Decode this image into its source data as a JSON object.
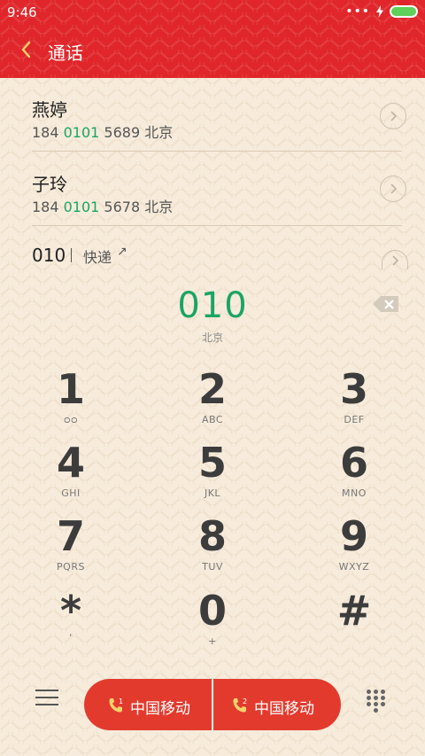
{
  "status": {
    "time": "9:46",
    "dots": "•••"
  },
  "header": {
    "title": "通话"
  },
  "contacts": [
    {
      "name": "燕婷",
      "num_pre": "184 ",
      "num_hl": "0101",
      "num_post": " 5689  北京"
    },
    {
      "name": "子玲",
      "num_pre": "184 ",
      "num_hl": "0101",
      "num_post": " 5678  北京"
    }
  ],
  "quick": {
    "number": "010",
    "link": "快递",
    "arrow": "↗"
  },
  "input": {
    "number": "010",
    "location": "北京"
  },
  "keys": [
    {
      "digit": "1",
      "letters": "ᴑᴑ"
    },
    {
      "digit": "2",
      "letters": "ABC"
    },
    {
      "digit": "3",
      "letters": "DEF"
    },
    {
      "digit": "4",
      "letters": "GHI"
    },
    {
      "digit": "5",
      "letters": "JKL"
    },
    {
      "digit": "6",
      "letters": "MNO"
    },
    {
      "digit": "7",
      "letters": "PQRS"
    },
    {
      "digit": "8",
      "letters": "TUV"
    },
    {
      "digit": "9",
      "letters": "WXYZ"
    },
    {
      "digit": "*",
      "letters": ","
    },
    {
      "digit": "0",
      "letters": "+"
    },
    {
      "digit": "#",
      "letters": ""
    }
  ],
  "call": {
    "sim1_label": "中国移动",
    "sim2_label": "中国移动",
    "sim1_index": "1",
    "sim2_index": "2"
  },
  "colors": {
    "header": "#e0262a",
    "accent_green": "#1aa564",
    "call_button": "#e23b2e"
  },
  "icons": [
    "back-icon",
    "battery-icon",
    "charging-icon",
    "chevron-right-icon",
    "backspace-icon",
    "menu-icon",
    "phone-icon",
    "dialpad-icon"
  ]
}
